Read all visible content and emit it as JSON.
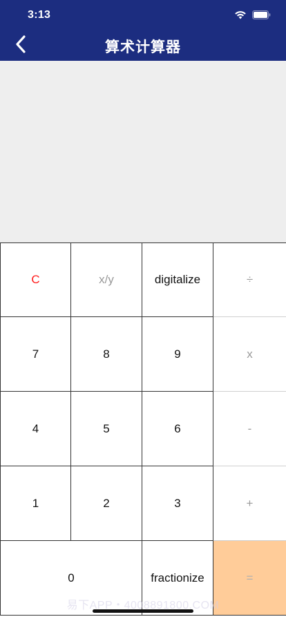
{
  "status": {
    "time": "3:13",
    "icons": [
      "wifi-icon",
      "battery-icon"
    ]
  },
  "nav": {
    "title": "算术计算器",
    "back_icon": "chevron-left-icon"
  },
  "keys": {
    "clear": "C",
    "fraction": "x/y",
    "digitalize": "digitalize",
    "divide": "÷",
    "seven": "7",
    "eight": "8",
    "nine": "9",
    "multiply": "x",
    "four": "4",
    "five": "5",
    "six": "6",
    "minus": "-",
    "one": "1",
    "two": "2",
    "three": "3",
    "plus": "+",
    "zero": "0",
    "fractionize": "fractionize",
    "equals": "="
  },
  "watermark": "易下APP・4008891800.COM",
  "colors": {
    "header": "#1c2d80",
    "display": "#eeeeee",
    "clear_text": "#ff1a1a",
    "equals_bg": "#ffcc99"
  }
}
